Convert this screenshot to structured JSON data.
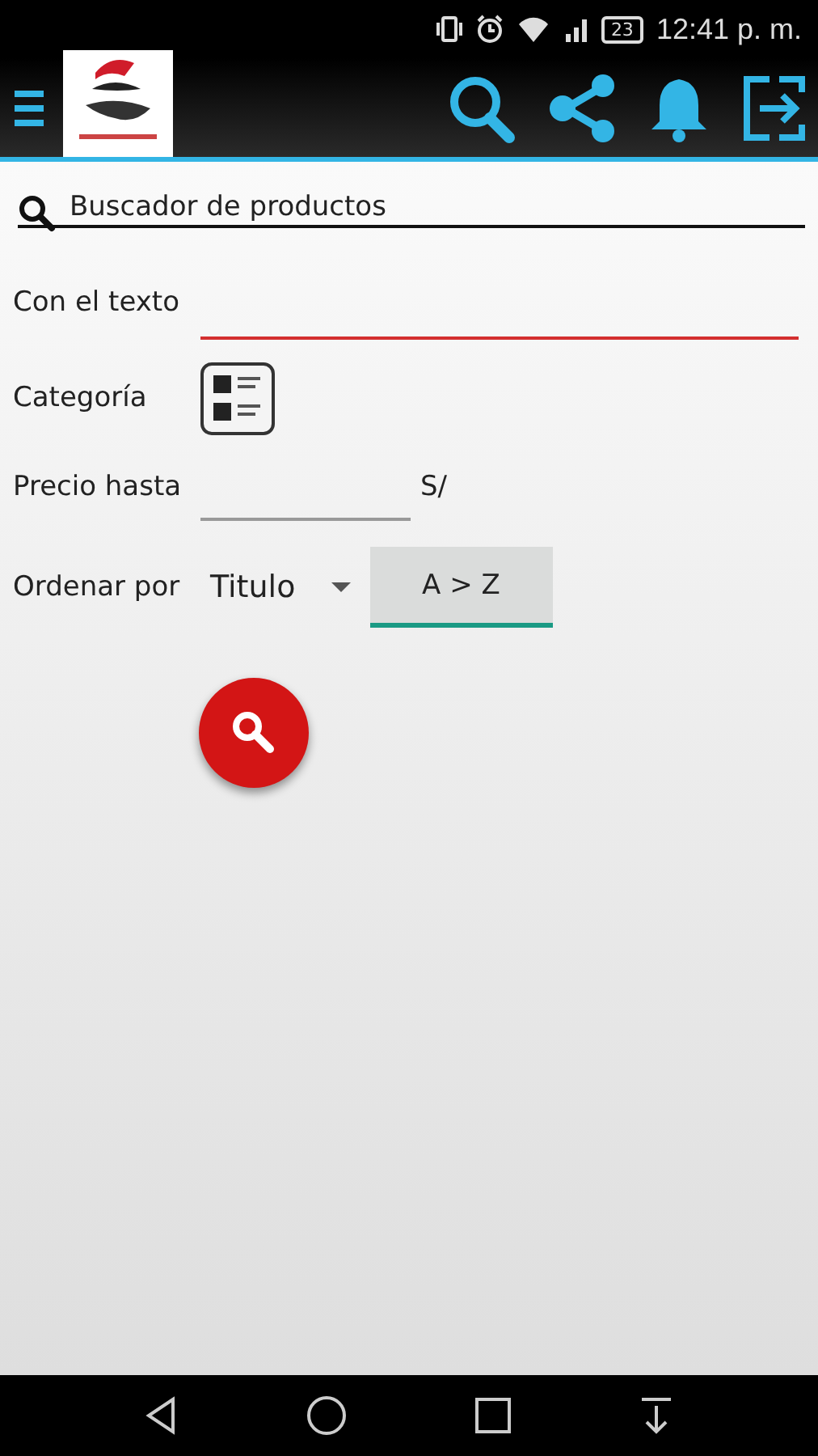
{
  "status_bar": {
    "battery": "23",
    "time": "12:41 p. m."
  },
  "search_title": "Buscador de productos",
  "form": {
    "text_field": {
      "label": "Con el texto",
      "focused": true
    },
    "category": {
      "label": "Categoría"
    },
    "price": {
      "label": "Precio hasta",
      "currency": "S/"
    },
    "sort": {
      "label": "Ordenar por",
      "value": "Titulo",
      "order": "A > Z"
    }
  }
}
